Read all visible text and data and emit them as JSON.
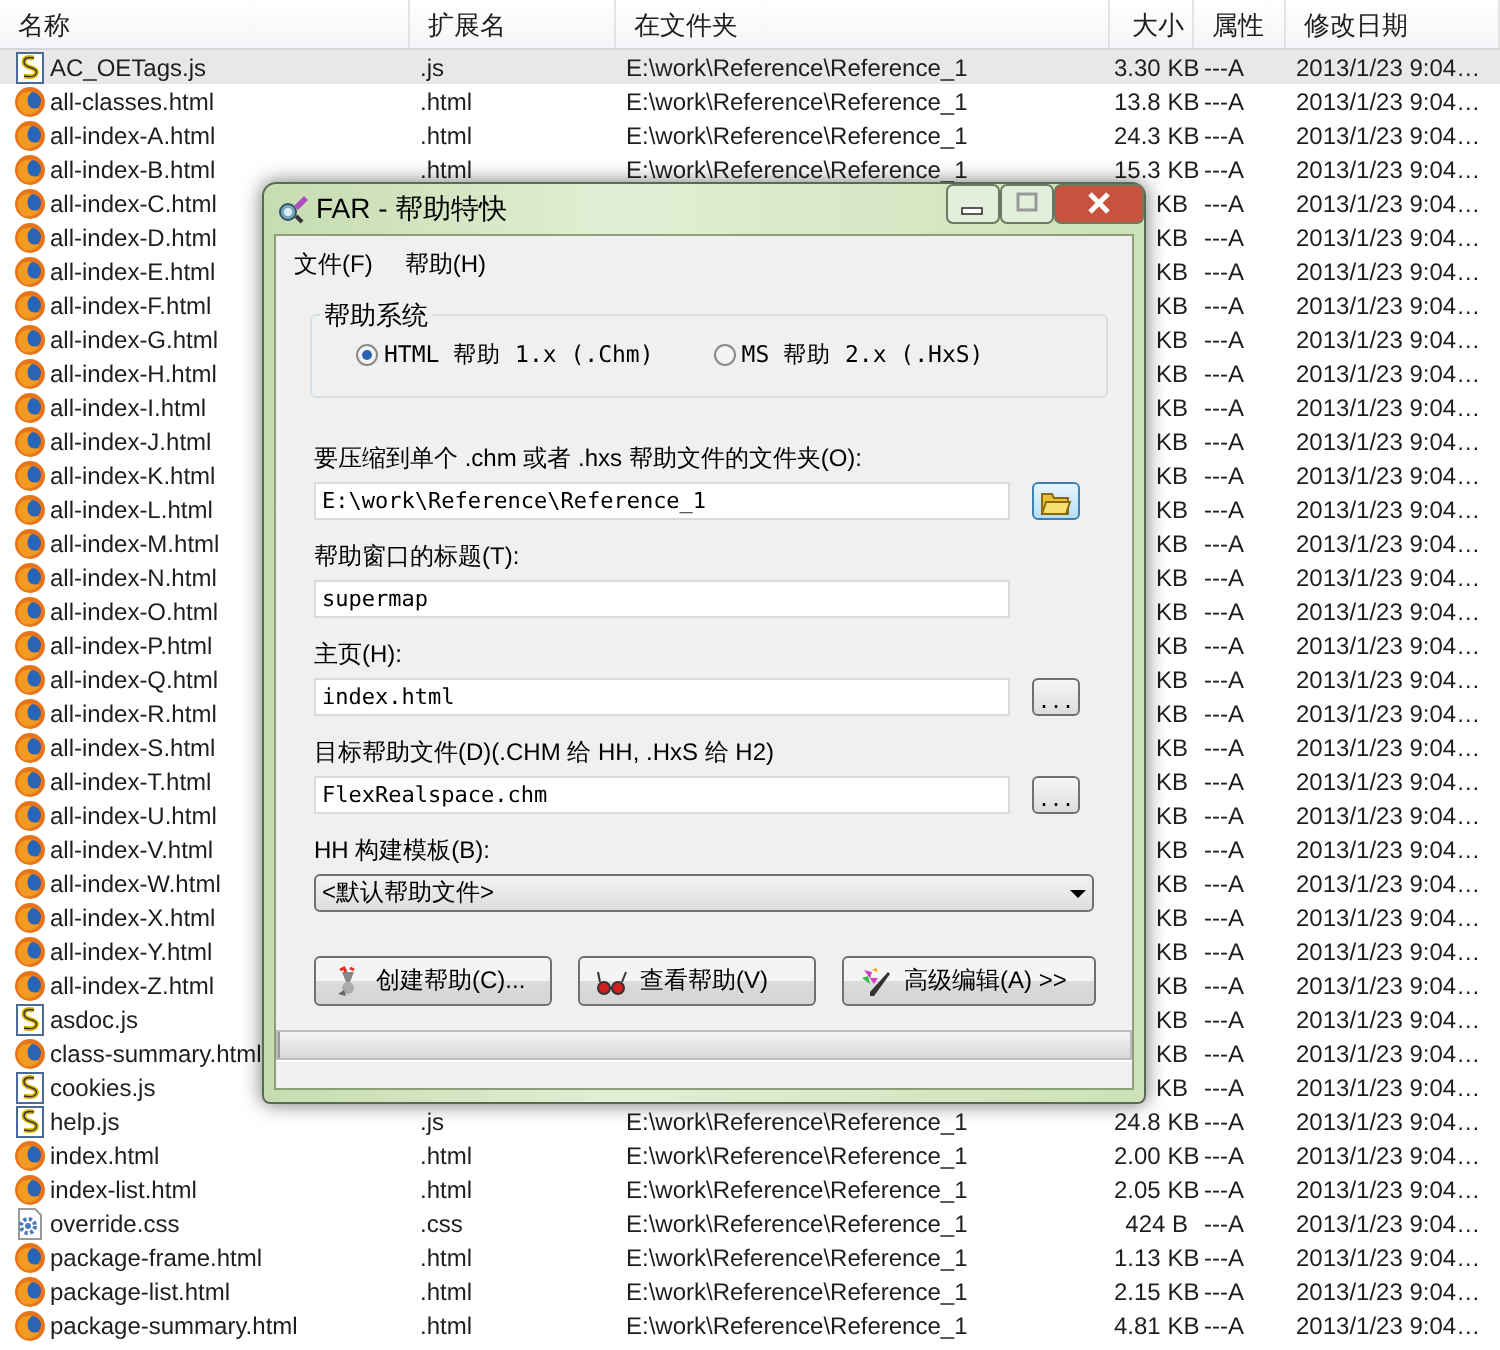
{
  "file_list": {
    "columns": [
      "名称",
      "扩展名",
      "在文件夹",
      "大小",
      "属性",
      "修改日期"
    ],
    "rows": [
      {
        "kind": "js",
        "name": "AC_OETags.js",
        "extension": ".js",
        "folder": "E:\\work\\Reference\\Reference_1",
        "size": "3.30 KB",
        "attributes": "---A",
        "modified": "2013/1/23 9:04…",
        "selected": true
      },
      {
        "kind": "html",
        "name": "all-classes.html",
        "extension": ".html",
        "folder": "E:\\work\\Reference\\Reference_1",
        "size": "13.8 KB",
        "attributes": "---A",
        "modified": "2013/1/23 9:04…",
        "selected": false
      },
      {
        "kind": "html",
        "name": "all-index-A.html",
        "extension": ".html",
        "folder": "E:\\work\\Reference\\Reference_1",
        "size": "24.3 KB",
        "attributes": "---A",
        "modified": "2013/1/23 9:04…",
        "selected": false
      },
      {
        "kind": "html",
        "name": "all-index-B.html",
        "extension": ".html",
        "folder": "E:\\work\\Reference\\Reference_1",
        "size": "15.3 KB",
        "attributes": "---A",
        "modified": "2013/1/23 9:04…",
        "selected": false
      },
      {
        "kind": "html",
        "name": "all-index-C.html",
        "size": "KB",
        "attributes": "---A",
        "modified": "2013/1/23 9:04…",
        "selected": false
      },
      {
        "kind": "html",
        "name": "all-index-D.html",
        "size": "KB",
        "attributes": "---A",
        "modified": "2013/1/23 9:04…",
        "selected": false
      },
      {
        "kind": "html",
        "name": "all-index-E.html",
        "size": "KB",
        "attributes": "---A",
        "modified": "2013/1/23 9:04…",
        "selected": false
      },
      {
        "kind": "html",
        "name": "all-index-F.html",
        "size": "KB",
        "attributes": "---A",
        "modified": "2013/1/23 9:04…",
        "selected": false
      },
      {
        "kind": "html",
        "name": "all-index-G.html",
        "size": "KB",
        "attributes": "---A",
        "modified": "2013/1/23 9:04…",
        "selected": false
      },
      {
        "kind": "html",
        "name": "all-index-H.html",
        "size": "KB",
        "attributes": "---A",
        "modified": "2013/1/23 9:04…",
        "selected": false
      },
      {
        "kind": "html",
        "name": "all-index-I.html",
        "size": "KB",
        "attributes": "---A",
        "modified": "2013/1/23 9:04…",
        "selected": false
      },
      {
        "kind": "html",
        "name": "all-index-J.html",
        "size": "KB",
        "attributes": "---A",
        "modified": "2013/1/23 9:04…",
        "selected": false
      },
      {
        "kind": "html",
        "name": "all-index-K.html",
        "size": "KB",
        "attributes": "---A",
        "modified": "2013/1/23 9:04…",
        "selected": false
      },
      {
        "kind": "html",
        "name": "all-index-L.html",
        "size": "KB",
        "attributes": "---A",
        "modified": "2013/1/23 9:04…",
        "selected": false
      },
      {
        "kind": "html",
        "name": "all-index-M.html",
        "size": "KB",
        "attributes": "---A",
        "modified": "2013/1/23 9:04…",
        "selected": false
      },
      {
        "kind": "html",
        "name": "all-index-N.html",
        "size": "KB",
        "attributes": "---A",
        "modified": "2013/1/23 9:04…",
        "selected": false
      },
      {
        "kind": "html",
        "name": "all-index-O.html",
        "size": "KB",
        "attributes": "---A",
        "modified": "2013/1/23 9:04…",
        "selected": false
      },
      {
        "kind": "html",
        "name": "all-index-P.html",
        "size": "KB",
        "attributes": "---A",
        "modified": "2013/1/23 9:04…",
        "selected": false
      },
      {
        "kind": "html",
        "name": "all-index-Q.html",
        "size": "KB",
        "attributes": "---A",
        "modified": "2013/1/23 9:04…",
        "selected": false
      },
      {
        "kind": "html",
        "name": "all-index-R.html",
        "size": "KB",
        "attributes": "---A",
        "modified": "2013/1/23 9:04…",
        "selected": false
      },
      {
        "kind": "html",
        "name": "all-index-S.html",
        "size": "KB",
        "attributes": "---A",
        "modified": "2013/1/23 9:04…",
        "selected": false
      },
      {
        "kind": "html",
        "name": "all-index-T.html",
        "size": "KB",
        "attributes": "---A",
        "modified": "2013/1/23 9:04…",
        "selected": false
      },
      {
        "kind": "html",
        "name": "all-index-U.html",
        "size": "KB",
        "attributes": "---A",
        "modified": "2013/1/23 9:04…",
        "selected": false
      },
      {
        "kind": "html",
        "name": "all-index-V.html",
        "size": "KB",
        "attributes": "---A",
        "modified": "2013/1/23 9:04…",
        "selected": false
      },
      {
        "kind": "html",
        "name": "all-index-W.html",
        "size": "KB",
        "attributes": "---A",
        "modified": "2013/1/23 9:04…",
        "selected": false
      },
      {
        "kind": "html",
        "name": "all-index-X.html",
        "size": "KB",
        "attributes": "---A",
        "modified": "2013/1/23 9:04…",
        "selected": false
      },
      {
        "kind": "html",
        "name": "all-index-Y.html",
        "size": "KB",
        "attributes": "---A",
        "modified": "2013/1/23 9:04…",
        "selected": false
      },
      {
        "kind": "html",
        "name": "all-index-Z.html",
        "size": "KB",
        "attributes": "---A",
        "modified": "2013/1/23 9:04…",
        "selected": false
      },
      {
        "kind": "js",
        "name": "asdoc.js",
        "size": "KB",
        "attributes": "---A",
        "modified": "2013/1/23 9:04…",
        "selected": false
      },
      {
        "kind": "html",
        "name": "class-summary.html",
        "size": "KB",
        "attributes": "---A",
        "modified": "2013/1/23 9:04…",
        "selected": false
      },
      {
        "kind": "js",
        "name": "cookies.js",
        "size": "KB",
        "attributes": "---A",
        "modified": "2013/1/23 9:04…",
        "selected": false
      },
      {
        "kind": "js",
        "name": "help.js",
        "extension": ".js",
        "folder": "E:\\work\\Reference\\Reference_1",
        "size": "24.8 KB",
        "attributes": "---A",
        "modified": "2013/1/23 9:04…",
        "selected": false
      },
      {
        "kind": "html",
        "name": "index.html",
        "extension": ".html",
        "folder": "E:\\work\\Reference\\Reference_1",
        "size": "2.00 KB",
        "attributes": "---A",
        "modified": "2013/1/23 9:04…",
        "selected": false
      },
      {
        "kind": "html",
        "name": "index-list.html",
        "extension": ".html",
        "folder": "E:\\work\\Reference\\Reference_1",
        "size": "2.05 KB",
        "attributes": "---A",
        "modified": "2013/1/23 9:04…",
        "selected": false
      },
      {
        "kind": "css",
        "name": "override.css",
        "extension": ".css",
        "folder": "E:\\work\\Reference\\Reference_1",
        "size": "424 B",
        "attributes": "---A",
        "modified": "2013/1/23 9:04…",
        "selected": false
      },
      {
        "kind": "html",
        "name": "package-frame.html",
        "extension": ".html",
        "folder": "E:\\work\\Reference\\Reference_1",
        "size": "1.13 KB",
        "attributes": "---A",
        "modified": "2013/1/23 9:04…",
        "selected": false
      },
      {
        "kind": "html",
        "name": "package-list.html",
        "extension": ".html",
        "folder": "E:\\work\\Reference\\Reference_1",
        "size": "2.15 KB",
        "attributes": "---A",
        "modified": "2013/1/23 9:04…",
        "selected": false
      },
      {
        "kind": "html",
        "name": "package-summary.html",
        "extension": ".html",
        "folder": "E:\\work\\Reference\\Reference_1",
        "size": "4.81 KB",
        "attributes": "---A",
        "modified": "2013/1/23 9:04…",
        "selected": false
      }
    ]
  },
  "dialog": {
    "title": "FAR - 帮助特快",
    "menu": [
      "文件(F)",
      "帮助(H)"
    ],
    "help_system": {
      "label": "帮助系统",
      "options": [
        {
          "label": "HTML 帮助 1.x (.Chm)",
          "selected": true
        },
        {
          "label": "MS 帮助 2.x (.HxS)",
          "selected": false
        }
      ]
    },
    "fields": [
      {
        "kind": "folder",
        "label": "要压缩到单个 .chm 或者 .hxs 帮助文件的文件夹(O):",
        "value": "E:\\work\\Reference\\Reference_1"
      },
      {
        "kind": "plain",
        "label": "帮助窗口的标题(T):",
        "value": "supermap"
      },
      {
        "kind": "browse",
        "label": "主页(H):",
        "value": "index.html",
        "button": "..."
      },
      {
        "kind": "browse",
        "label": "目标帮助文件(D)(.CHM 给 HH, .HxS 给 H2)",
        "value": "FlexRealspace.chm",
        "button": "..."
      },
      {
        "kind": "dropdown",
        "label": "HH 构建模板(B):",
        "value": "<默认帮助文件>"
      }
    ],
    "buttons": [
      {
        "kind": "create",
        "label": "创建帮助(C)..."
      },
      {
        "kind": "view",
        "label": "查看帮助(V)"
      },
      {
        "kind": "advanced",
        "label": "高级编辑(A) >>"
      }
    ],
    "progress": {
      "level": 0
    }
  }
}
